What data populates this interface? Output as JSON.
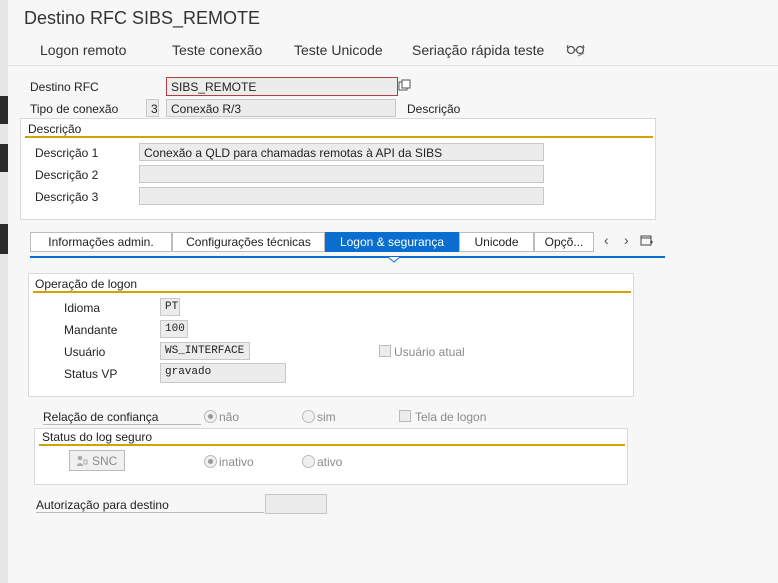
{
  "window": {
    "title": "Destino RFC SIBS_REMOTE"
  },
  "toolbar": {
    "logon_remoto": "Logon remoto",
    "teste_conexao": "Teste conexão",
    "teste_unicode": "Teste Unicode",
    "seriacao": "Seriação rápida teste"
  },
  "header": {
    "destino_label": "Destino RFC",
    "destino_value": "SIBS_REMOTE",
    "tipo_label": "Tipo de conexão",
    "tipo_code": "3",
    "tipo_desc": "Conexão R/3",
    "descricao_side": "Descrição"
  },
  "descricao_group": {
    "title": "Descrição",
    "rows": [
      {
        "label": "Descrição 1",
        "value": "Conexão a QLD para chamadas remotas à API da SIBS"
      },
      {
        "label": "Descrição 2",
        "value": ""
      },
      {
        "label": "Descrição 3",
        "value": ""
      }
    ]
  },
  "tabs": [
    {
      "label": "Informações admin."
    },
    {
      "label": "Configurações técnicas"
    },
    {
      "label": "Logon & segurança"
    },
    {
      "label": "Unicode"
    },
    {
      "label": "Opçõ..."
    }
  ],
  "logon": {
    "title": "Operação de logon",
    "idioma_label": "Idioma",
    "idioma_value": "PT",
    "mandante_label": "Mandante",
    "mandante_value": "100",
    "usuario_label": "Usuário",
    "usuario_value": "WS_INTERFACE",
    "usuario_atual_label": "Usuário atual",
    "status_label": "Status VP",
    "status_value": "gravado"
  },
  "confianca": {
    "label": "Relação de confiança",
    "nao": "não",
    "sim": "sim",
    "tela": "Tela de logon"
  },
  "log_seguro": {
    "title": "Status do log seguro",
    "snc": "SNC",
    "inativo": "inativo",
    "ativo": "ativo"
  },
  "autorizacao": {
    "label": "Autorização para destino",
    "value": ""
  }
}
